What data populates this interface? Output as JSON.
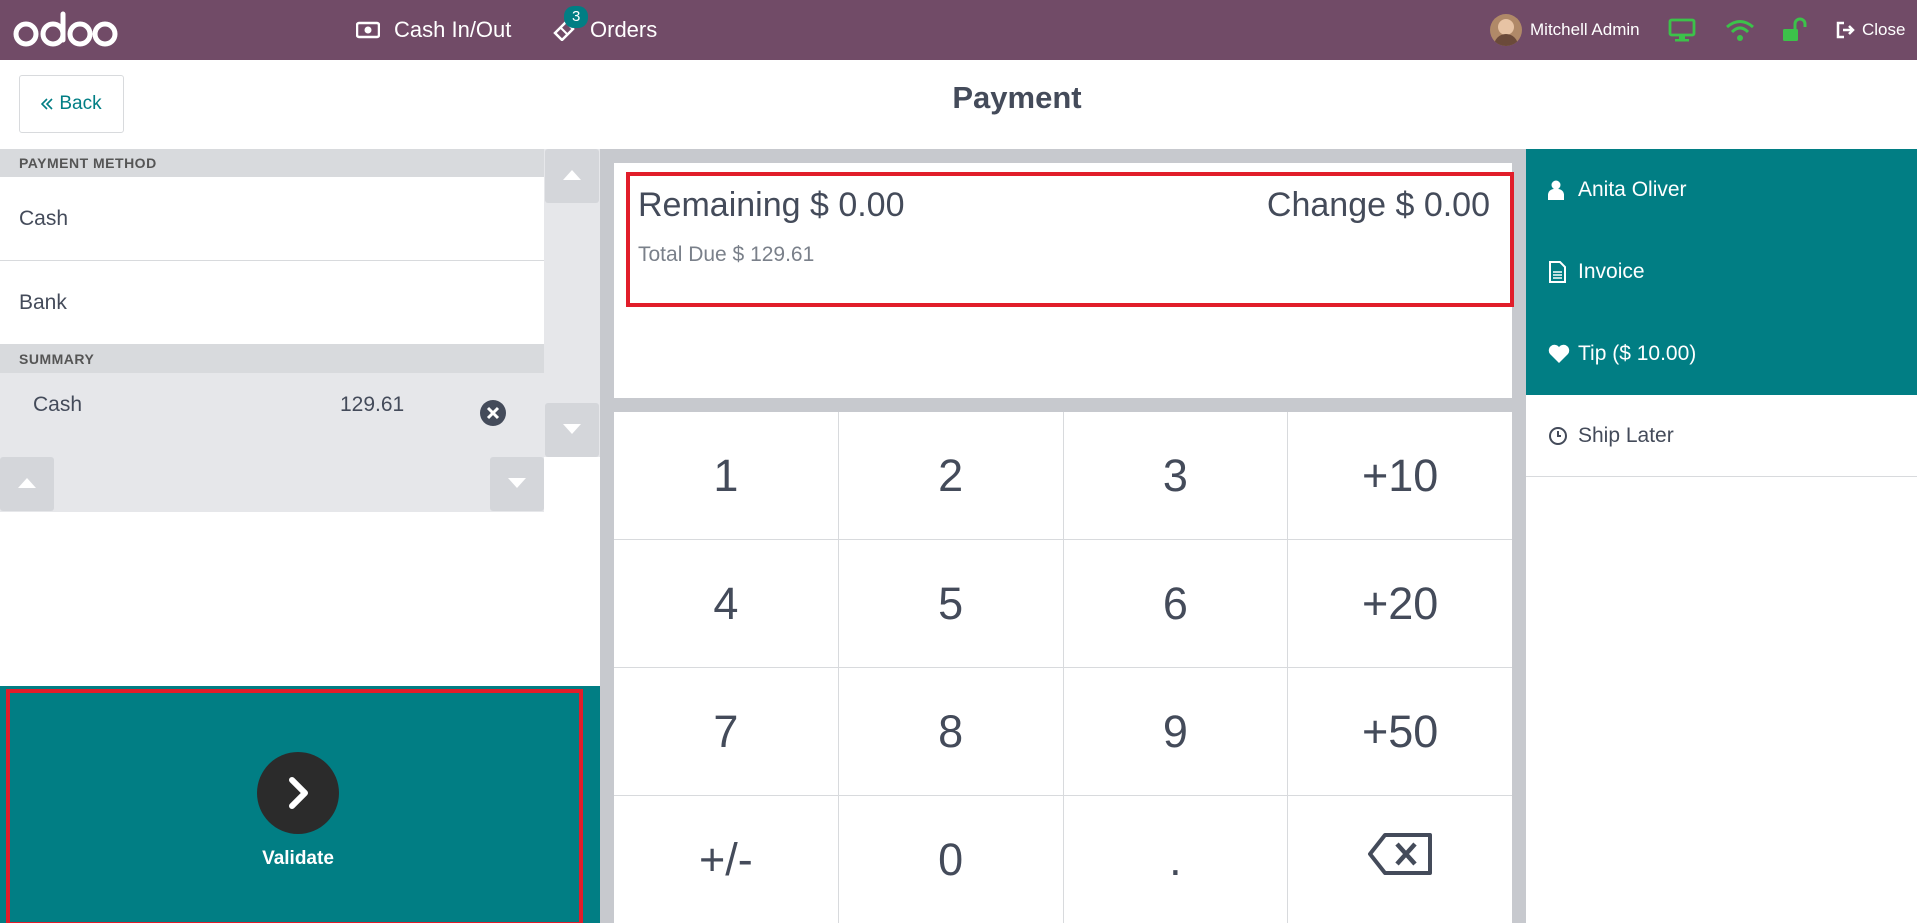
{
  "topbar": {
    "logo": "odoo",
    "cash_in_out": "Cash In/Out",
    "orders": "Orders",
    "orders_badge": "3",
    "user_name": "Mitchell Admin",
    "close": "Close"
  },
  "header": {
    "back": "Back",
    "title": "Payment"
  },
  "left": {
    "payment_method_header": "PAYMENT METHOD",
    "methods": [
      "Cash",
      "Bank"
    ],
    "summary_header": "SUMMARY",
    "summary_line": {
      "name": "Cash",
      "amount": "129.61"
    },
    "validate": "Validate"
  },
  "status": {
    "remaining": "Remaining $ 0.00",
    "change": "Change $ 0.00",
    "total_due": "Total Due  $ 129.61"
  },
  "numpad": {
    "keys": [
      "1",
      "2",
      "3",
      "+10",
      "4",
      "5",
      "6",
      "+20",
      "7",
      "8",
      "9",
      "+50",
      "+/-",
      "0",
      "."
    ]
  },
  "right": {
    "customer": "Anita Oliver",
    "invoice": "Invoice",
    "tip": "Tip ($ 10.00)",
    "ship_later": "Ship Later"
  },
  "colors": {
    "topbar": "#714b67",
    "teal": "#017e84",
    "highlight": "#e11d2a"
  }
}
